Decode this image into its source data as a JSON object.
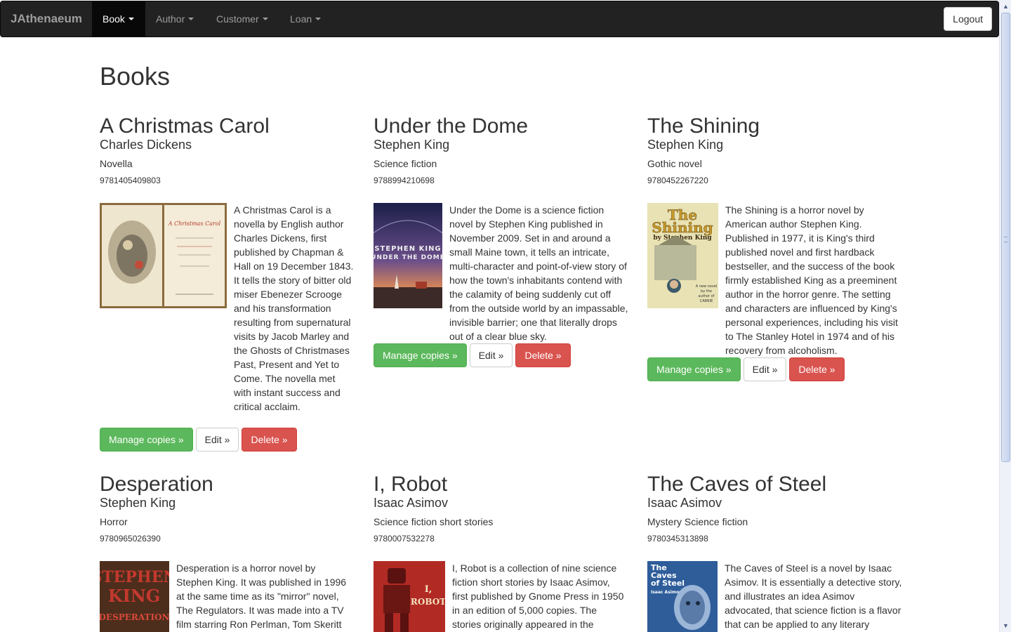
{
  "navbar": {
    "brand": "JAthenaeum",
    "items": [
      {
        "label": "Book",
        "active": true
      },
      {
        "label": "Author",
        "active": false
      },
      {
        "label": "Customer",
        "active": false
      },
      {
        "label": "Loan",
        "active": false
      }
    ],
    "logout_label": "Logout"
  },
  "page_title": "Books",
  "buttons": {
    "manage": "Manage copies »",
    "edit": "Edit »",
    "delete": "Delete »"
  },
  "colors": {
    "navbar_bg": "#222222",
    "success": "#5cb85c",
    "danger": "#d9534f"
  },
  "books": [
    {
      "title": "A Christmas Carol",
      "author": "Charles Dickens",
      "genre": "Novella",
      "isbn": "9781405409803",
      "description": "A Christmas Carol is a novella by English author Charles Dickens, first published by Chapman & Hall on 19 December 1843. It tells the story of bitter old miser Ebenezer Scrooge and his transformation resulting from supernatural visits by Jacob Marley and the Ghosts of Christmases Past, Present and Yet to Come. The novella met with instant success and critical acclaim.",
      "cover_text": "A CHRISTMAS CAROL"
    },
    {
      "title": "Under the Dome",
      "author": "Stephen King",
      "genre": "Science fiction",
      "isbn": "9788994210698",
      "description": "Under the Dome is a science fiction novel by Stephen King published in November 2009. Set in and around a small Maine town, it tells an intricate, multi-character and point-of-view story of how the town's inhabitants contend with the calamity of being suddenly cut off from the outside world by an impassable, invisible barrier; one that literally drops out of a clear blue sky.",
      "cover_text": "STEPHEN KING UNDER THE DOME"
    },
    {
      "title": "The Shining",
      "author": "Stephen King",
      "genre": "Gothic novel",
      "isbn": "9780452267220",
      "description": "The Shining is a horror novel by American author Stephen King. Published in 1977, it is King's third published novel and first hardback bestseller, and the success of the book firmly established King as a preeminent author in the horror genre. The setting and characters are influenced by King's personal experiences, including his visit to The Stanley Hotel in 1974 and of his recovery from alcoholism.",
      "cover_text": "The Shining by Stephen King"
    },
    {
      "title": "Desperation",
      "author": "Stephen King",
      "genre": "Horror",
      "isbn": "9780965026390",
      "description": "Desperation is a horror novel by Stephen King. It was published in 1996 at the same time as its \"mirror\" novel, The Regulators. It was made into a TV film starring Ron Perlman, Tom Skeritt",
      "cover_text": "STEPHEN KING DESPERATION"
    },
    {
      "title": "I, Robot",
      "author": "Isaac Asimov",
      "genre": "Science fiction short stories",
      "isbn": "9780007532278",
      "description": "I, Robot is a collection of nine science fiction short stories by Isaac Asimov, first published by Gnome Press in 1950 in an edition of 5,000 copies. The stories originally appeared in the",
      "cover_text": "I, ROBOT"
    },
    {
      "title": "The Caves of Steel",
      "author": "Isaac Asimov",
      "genre": "Mystery Science fiction",
      "isbn": "9780345313898",
      "description": "The Caves of Steel is a novel by Isaac Asimov. It is essentially a detective story, and illustrates an idea Asimov advocated, that science fiction is a flavor that can be applied to any literary",
      "cover_text": "The Caves of Steel Isaac Asimov"
    }
  ]
}
